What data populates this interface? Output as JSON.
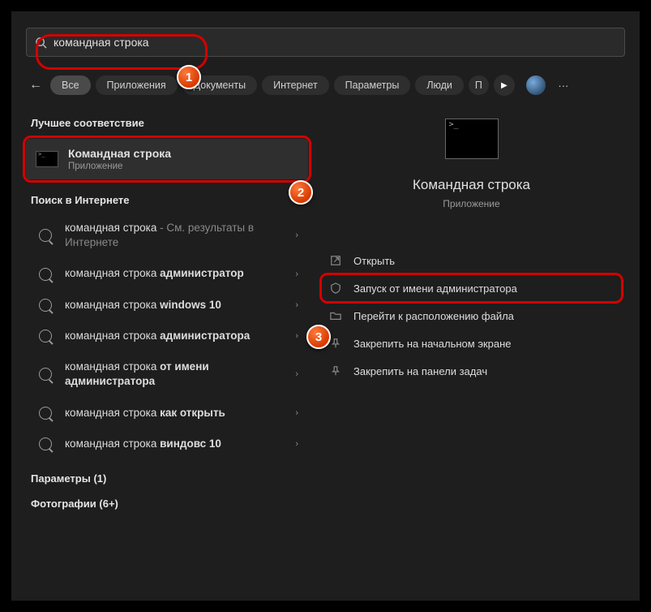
{
  "search": {
    "value": "командная строка"
  },
  "filters": {
    "items": [
      "Все",
      "Приложения",
      "Документы",
      "Интернет",
      "Параметры",
      "Люди",
      "П"
    ]
  },
  "best_match": {
    "heading": "Лучшее соответствие",
    "title": "Командная строка",
    "subtitle": "Приложение"
  },
  "web": {
    "heading": "Поиск в Интернете",
    "items": [
      {
        "pre": "командная строка",
        "dim_suffix": " - См. результаты в Интернете",
        "bold": ""
      },
      {
        "pre": "командная строка ",
        "bold": "администратор"
      },
      {
        "pre": "командная строка ",
        "bold": "windows 10"
      },
      {
        "pre": "командная строка ",
        "bold": "администратора"
      },
      {
        "pre": "командная строка ",
        "bold": "от имени администратора"
      },
      {
        "pre": "командная строка ",
        "bold": "как открыть"
      },
      {
        "pre": "командная строка ",
        "bold": "виндовс 10"
      }
    ]
  },
  "categories": [
    "Параметры (1)",
    "Фотографии (6+)"
  ],
  "preview": {
    "title": "Командная строка",
    "subtitle": "Приложение"
  },
  "actions": [
    {
      "icon": "open",
      "label": "Открыть"
    },
    {
      "icon": "admin",
      "label": "Запуск от имени администратора",
      "highlight": true
    },
    {
      "icon": "folder",
      "label": "Перейти к расположению файла"
    },
    {
      "icon": "pin",
      "label": "Закрепить на начальном экране"
    },
    {
      "icon": "pin",
      "label": "Закрепить на панели задач"
    }
  ],
  "steps": {
    "1": "1",
    "2": "2",
    "3": "3"
  }
}
